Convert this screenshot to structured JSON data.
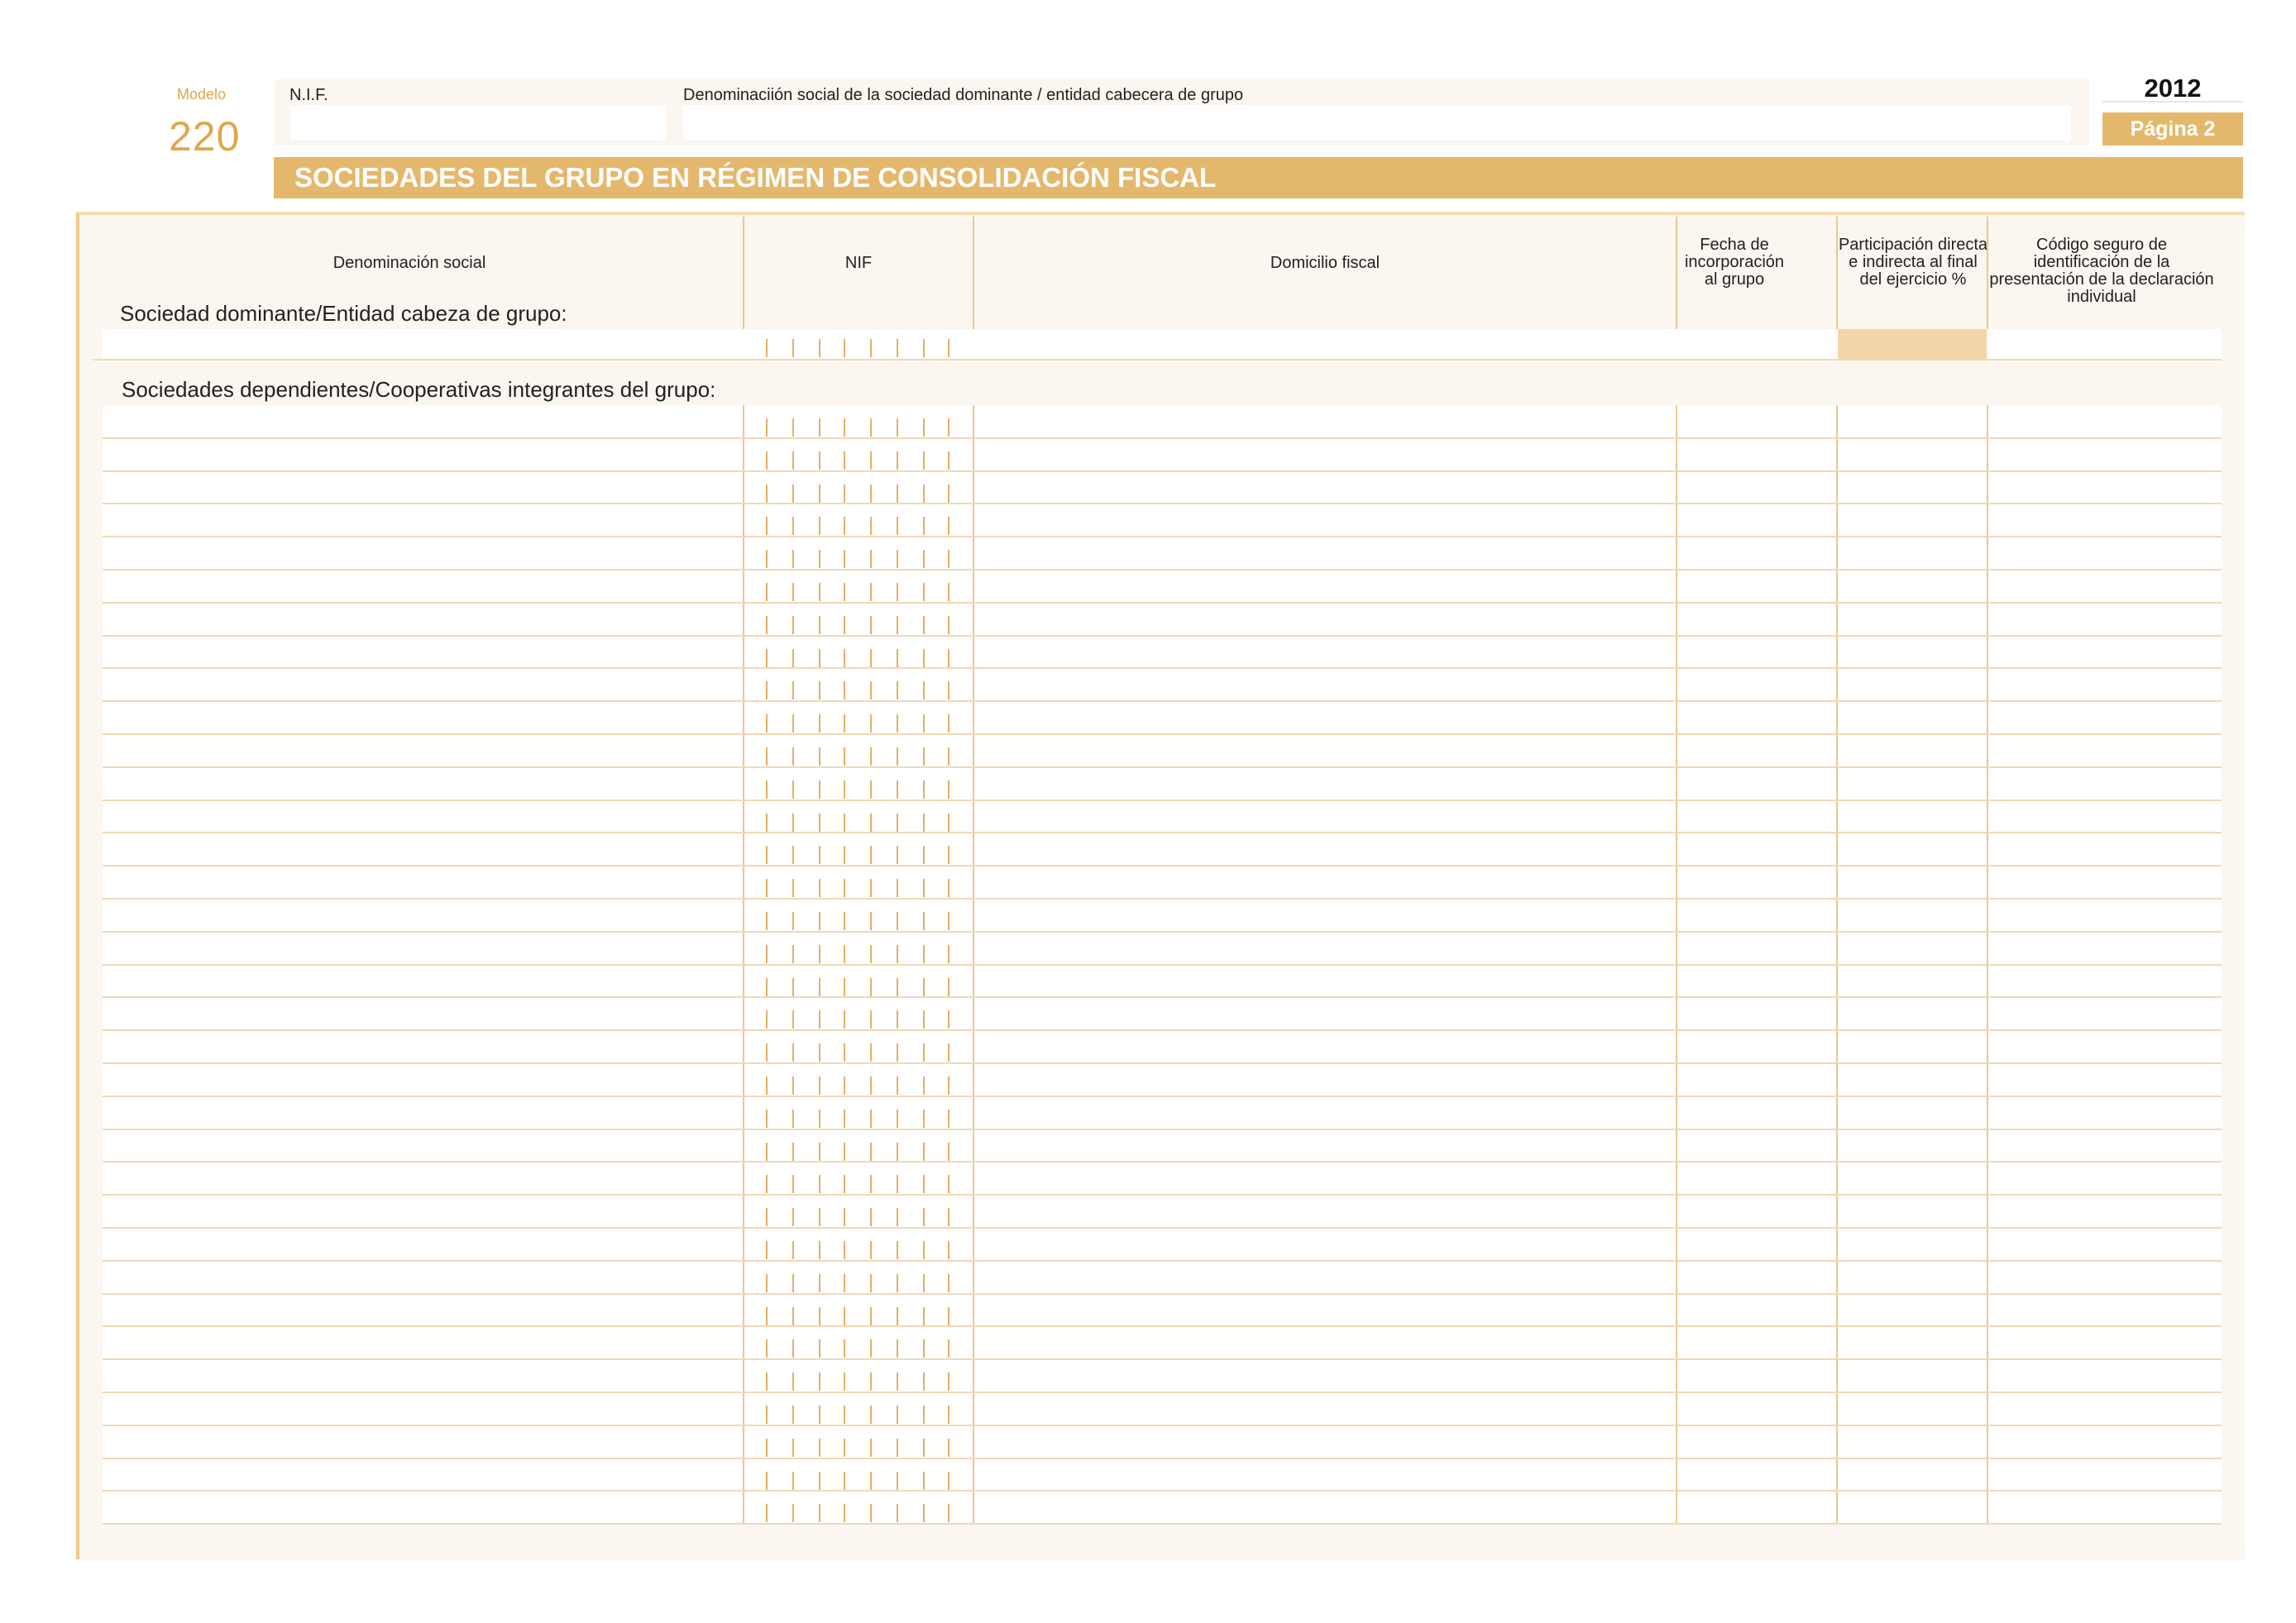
{
  "header": {
    "modelo_label": "Modelo",
    "modelo_number": "220",
    "nif_label": "N.I.F.",
    "nif_value": "",
    "denominacion_label": "Denominaciión social de la sociedad dominante / entidad cabecera de grupo",
    "denominacion_value": "",
    "year": "2012",
    "page_label": "Página 2"
  },
  "title": "SOCIEDADES DEL GRUPO EN RÉGIMEN DE CONSOLIDACIÓN FISCAL",
  "table": {
    "columns": [
      "Denominación social",
      "NIF",
      "Domicilio fiscal",
      "Fecha de incorporación al grupo",
      "Participación directa e indirecta al final del ejercicio %",
      "Código seguro de identificación de la presentación de la declaración individual"
    ],
    "dominant_label": "Sociedad dominante/Entidad cabeza de grupo:",
    "dependent_label": "Sociedades dependientes/Cooperativas integrantes del grupo:",
    "dependent_row_count": 34
  },
  "colors": {
    "accent": "#e4b86c",
    "panel": "#fbf6f0",
    "line": "#ecc88c",
    "shade": "#f3d6a8"
  }
}
